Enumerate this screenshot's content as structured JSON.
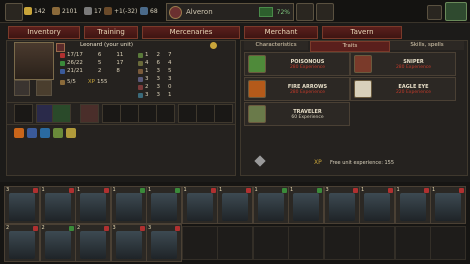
{
  "topbar": {
    "resources": [
      "142",
      "2101",
      "17",
      "+1(-32)",
      "68"
    ],
    "hero": {
      "name": "Alveron",
      "percent": "72%"
    }
  },
  "tabs": [
    "Inventory",
    "Training",
    "Mercenaries",
    "Merchant",
    "Tavern"
  ],
  "unit": {
    "name": "Leonard (your unit)",
    "stats_left": [
      [
        "17/17",
        "6",
        "11"
      ],
      [
        "26/22",
        "5",
        "17"
      ],
      [
        "21/21",
        "2",
        "8"
      ],
      [
        "5/5",
        "XP",
        "155"
      ]
    ],
    "stats_right": [
      [
        "1",
        "2",
        "7"
      ],
      [
        "4",
        "6",
        "4"
      ],
      [
        "1",
        "3",
        "5"
      ],
      [
        "3",
        "3",
        "3"
      ],
      [
        "2",
        "3",
        "0"
      ],
      [
        "3",
        "3",
        "1"
      ]
    ],
    "xp_label": "XP",
    "xp_value": "155"
  },
  "subtabs": [
    "Characteristics",
    "Traits",
    "Skills, spells"
  ],
  "traits": [
    {
      "name": "POISONOUS",
      "cost": "280 Experience",
      "color": "#4f8a3a"
    },
    {
      "name": "SNIPER",
      "cost": "280 Experience",
      "color": "#7a3a2a"
    },
    {
      "name": "FIRE ARROWS",
      "cost": "280 Experience",
      "color": "#b45a1a"
    },
    {
      "name": "EAGLE EYE",
      "cost": "220 Experience",
      "color": "#d8d0bb"
    },
    {
      "name": "TRAVELER",
      "cost": "60 Experience",
      "color": "#6a7a4a"
    }
  ],
  "free_xp": {
    "label": "XP",
    "text": "Free unit experience: 155"
  },
  "army_row1": [
    {
      "level": "3",
      "badge": "#b03030"
    },
    {
      "level": "1",
      "badge": "#b03030"
    },
    {
      "level": "1",
      "badge": "#b03030"
    },
    {
      "level": "1",
      "badge": "#3a8a3a"
    },
    {
      "level": "1",
      "badge": "#3a8a3a"
    },
    {
      "level": "1",
      "badge": "#b03030"
    },
    {
      "level": "1",
      "badge": "#b03030"
    },
    {
      "level": "1",
      "badge": "#3a8a3a"
    },
    {
      "level": "1",
      "badge": "#3a8a3a"
    },
    {
      "level": "3",
      "badge": "#b03030"
    },
    {
      "level": "1",
      "badge": "#b03030"
    },
    {
      "level": "1",
      "badge": "#b03030"
    },
    {
      "level": "1",
      "badge": "#b03030"
    }
  ],
  "army_row2": [
    {
      "level": "2",
      "badge": "#b03030"
    },
    {
      "level": "2",
      "badge": "#3a8a3a"
    },
    {
      "level": "2",
      "badge": "#b03030"
    },
    {
      "level": "3",
      "badge": "#b03030"
    },
    {
      "level": "3",
      "badge": "#b03030"
    }
  ]
}
